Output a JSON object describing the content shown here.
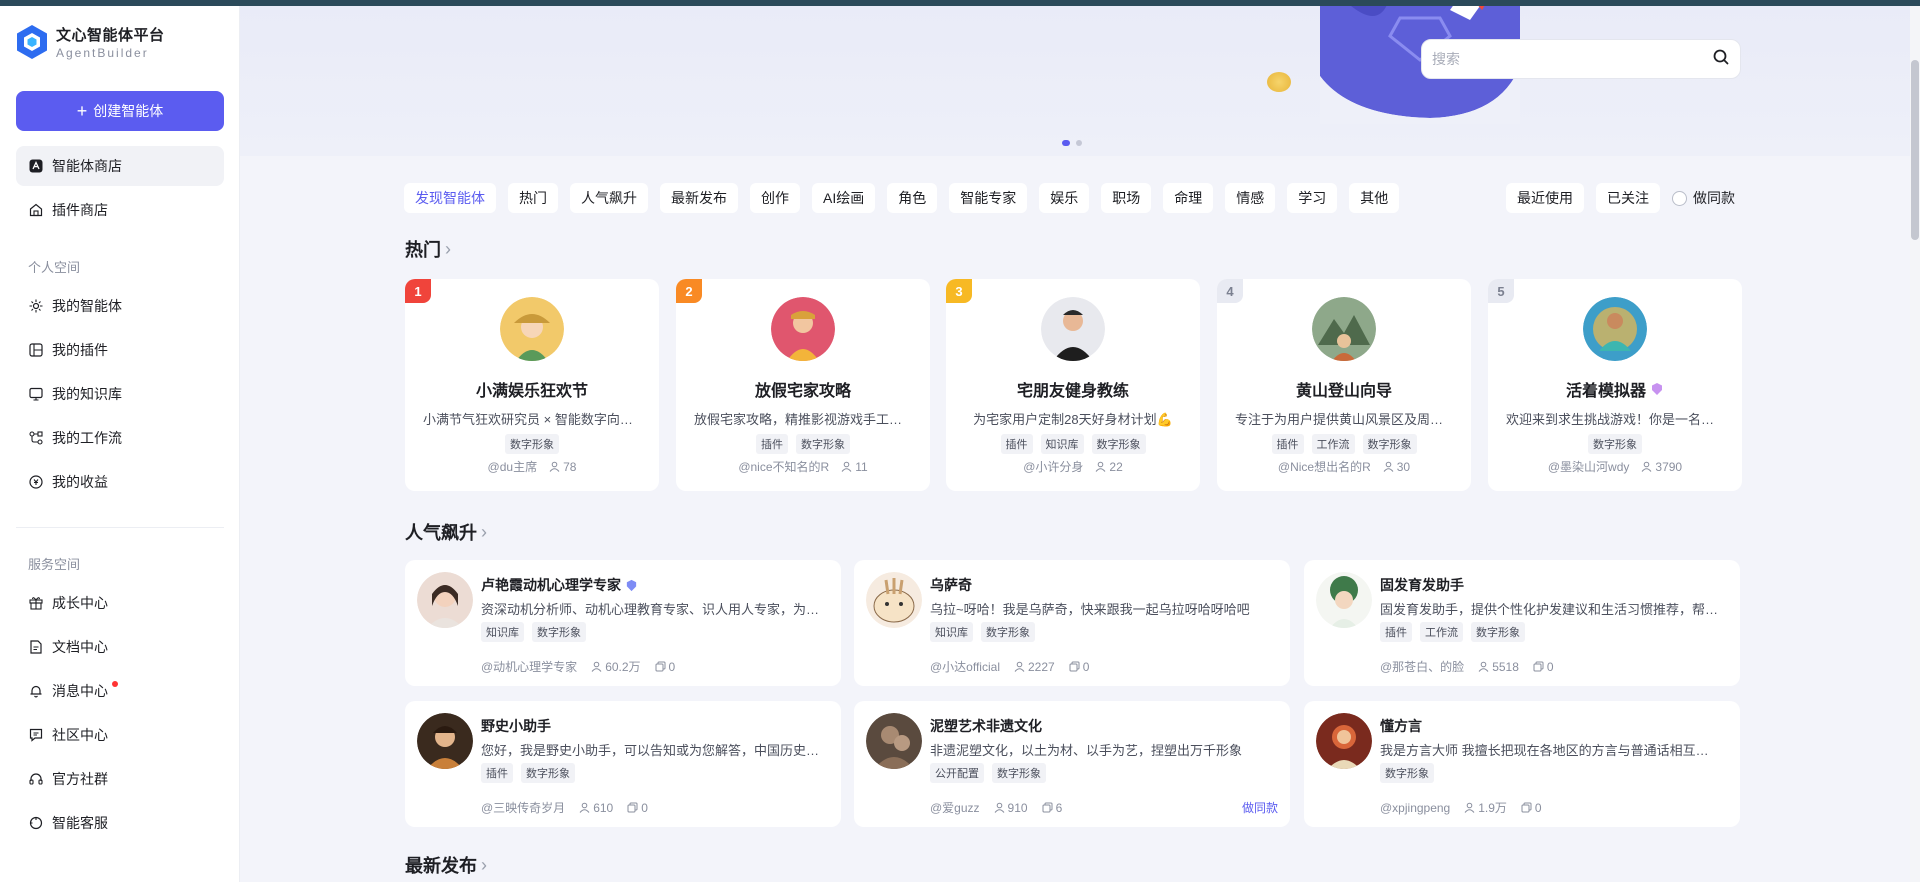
{
  "brand": {
    "title": "文心智能体平台",
    "subtitle": "AgentBuilder",
    "accent": "#5b5cf0"
  },
  "sidebar": {
    "create_label": "创建智能体",
    "top_items": [
      {
        "label": "智能体商店",
        "icon": "store-icon",
        "active": true
      },
      {
        "label": "插件商店",
        "icon": "plugin-store-icon",
        "active": false
      }
    ],
    "personal_section": "个人空间",
    "personal_items": [
      {
        "label": "我的智能体",
        "icon": "agent-icon"
      },
      {
        "label": "我的插件",
        "icon": "plugin-icon"
      },
      {
        "label": "我的知识库",
        "icon": "knowledge-icon"
      },
      {
        "label": "我的工作流",
        "icon": "workflow-icon"
      },
      {
        "label": "我的收益",
        "icon": "earnings-icon"
      }
    ],
    "service_section": "服务空间",
    "service_items": [
      {
        "label": "成长中心",
        "icon": "gift-icon"
      },
      {
        "label": "文档中心",
        "icon": "document-icon"
      },
      {
        "label": "消息中心",
        "icon": "bell-icon",
        "has_dot": true
      },
      {
        "label": "社区中心",
        "icon": "community-icon"
      },
      {
        "label": "官方社群",
        "icon": "headset-icon"
      },
      {
        "label": "智能客服",
        "icon": "support-icon"
      }
    ]
  },
  "search": {
    "placeholder": "搜索"
  },
  "filters": [
    "发现智能体",
    "热门",
    "人气飙升",
    "最新发布",
    "创作",
    "AI绘画",
    "角色",
    "智能专家",
    "娱乐",
    "职场",
    "命理",
    "情感",
    "学习",
    "其他"
  ],
  "right_filters": {
    "recent": "最近使用",
    "followed": "已关注",
    "make_same": "做同款"
  },
  "sections": {
    "hot": "热门",
    "rising": "人气飙升",
    "newest": "最新发布"
  },
  "hot_cards": [
    {
      "rank": "1",
      "rank_color": "#f0443b",
      "name": "小满娱乐狂欢节",
      "desc": "小满节气狂欢研究员 × 智能数字向导，欢迎来体验",
      "tags": [
        "数字形象"
      ],
      "author": "@du主席",
      "users": "78"
    },
    {
      "rank": "2",
      "rank_color": "#f98a24",
      "name": "放假宅家攻略",
      "desc": "放假宅家攻略，精推影视游戏手工美食",
      "tags": [
        "插件",
        "数字形象"
      ],
      "author": "@nice不知名的R",
      "users": "11"
    },
    {
      "rank": "3",
      "rank_color": "#f7b924",
      "name": "宅朋友健身教练",
      "desc": "为宅家用户定制28天好身材计划💪",
      "tags": [
        "插件",
        "知识库",
        "数字形象"
      ],
      "author": "@小许分身",
      "users": "22"
    },
    {
      "rank": "4",
      "rank_color": "",
      "name": "黄山登山向导",
      "desc": "专注于为用户提供黄山风景区及周边旅游信息",
      "tags": [
        "插件",
        "工作流",
        "数字形象"
      ],
      "author": "@Nice想出名的R",
      "users": "30"
    },
    {
      "rank": "5",
      "rank_color": "",
      "name": "活着模拟器",
      "desc": "欢迎来到求生挑战游戏！你是一名幸存者",
      "tags": [
        "数字形象"
      ],
      "author": "@墨染山河wdy",
      "users": "3790"
    }
  ],
  "popular_cards": [
    {
      "name": "卢艳霞动机心理学专家",
      "verified": true,
      "desc": "资深动机分析师、动机心理教育专家、识人用人专家，为你答疑",
      "tags": [
        "知识库",
        "数字形象"
      ],
      "author": "@动机心理学专家",
      "users": "60.2万",
      "copies": "0",
      "same": ""
    },
    {
      "name": "乌萨奇",
      "verified": false,
      "desc": "乌拉~呀哈！我是乌萨奇，快来跟我一起乌拉呀哈呀哈吧",
      "tags": [
        "知识库",
        "数字形象"
      ],
      "author": "@小达official",
      "users": "2227",
      "copies": "0",
      "same": ""
    },
    {
      "name": "固发育发助手",
      "verified": false,
      "desc": "固发育发助手，提供个性化护发建议和生活习惯推荐，帮你养出好发",
      "tags": [
        "插件",
        "工作流",
        "数字形象"
      ],
      "author": "@那苍白、的脸",
      "users": "5518",
      "copies": "0",
      "same": ""
    },
    {
      "name": "野史小助手",
      "verified": false,
      "desc": "您好，我是野史小助手，可以告知或为您解答，中国历史上的野史",
      "tags": [
        "插件",
        "数字形象"
      ],
      "author": "@三映传奇岁月",
      "users": "610",
      "copies": "0",
      "same": ""
    },
    {
      "name": "泥塑艺术非遗文化",
      "verified": false,
      "desc": "非遗泥塑文化，以土为材、以手为艺，捏塑出万千形象",
      "tags": [
        "公开配置",
        "数字形象"
      ],
      "author": "@爱guzz",
      "users": "910",
      "copies": "6",
      "same": "做同款"
    },
    {
      "name": "懂方言",
      "verified": false,
      "desc": "我是方言大师 我擅长把现在各地区的方言与普通话相互转换",
      "tags": [
        "数字形象"
      ],
      "author": "@xpjingpeng",
      "users": "1.9万",
      "copies": "0",
      "same": ""
    }
  ]
}
